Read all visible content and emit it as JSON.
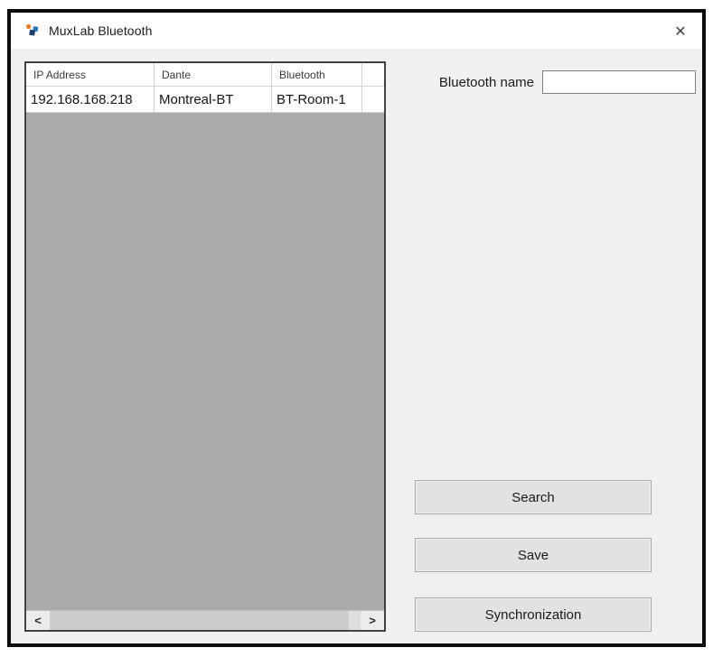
{
  "colors": {
    "frame": "#0d0d0d",
    "titlebar-bg": "#ffffff",
    "client-bg": "#f0f0f0",
    "table-border": "#424242",
    "table-empty": "#aaaaaa",
    "grid-line": "#d4d4d4",
    "button-bg": "#e2e2e2",
    "button-border": "#a9a9a9",
    "logo-orange": "#e87e2b",
    "logo-blue": "#2f7cb5",
    "logo-navy": "#1c3e6e"
  },
  "window": {
    "title": "MuxLab Bluetooth"
  },
  "icons": {
    "close": "✕",
    "scroll_left": "<",
    "scroll_right": ">"
  },
  "table": {
    "columns": [
      "IP Address",
      "Dante",
      "Bluetooth"
    ],
    "rows": [
      [
        "192.168.168.218",
        "Montreal-BT",
        "BT-Room-1"
      ]
    ]
  },
  "form": {
    "bluetooth_name_label": "Bluetooth name",
    "bluetooth_name_value": "",
    "buttons": {
      "search": "Search",
      "save": "Save",
      "synchronization": "Synchronization"
    }
  }
}
